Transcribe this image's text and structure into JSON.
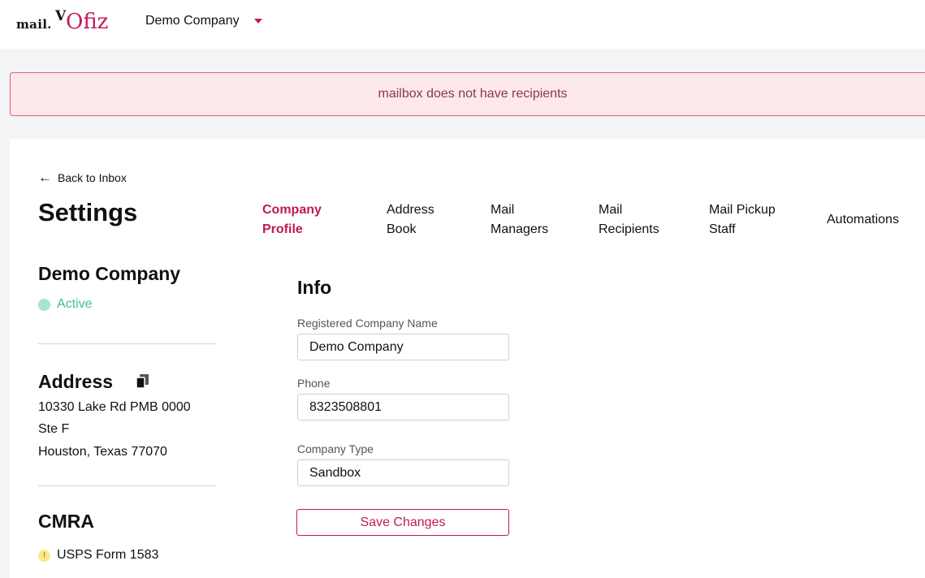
{
  "header": {
    "logo": {
      "prefix": "mail.",
      "v": "V",
      "brand": "Ofiz"
    },
    "company_selector": {
      "name": "Demo Company",
      "icon": "caret-down-icon"
    }
  },
  "alert": {
    "message": "mailbox does not have recipients"
  },
  "nav": {
    "back_label": "Back to Inbox",
    "back_icon": "arrow-left-icon"
  },
  "page": {
    "title": "Settings"
  },
  "tabs": [
    {
      "line1": "Company",
      "line2": "Profile",
      "active": true
    },
    {
      "line1": "Address",
      "line2": "Book"
    },
    {
      "line1": "Mail",
      "line2": "Managers"
    },
    {
      "line1": "Mail",
      "line2": "Recipients"
    },
    {
      "line1": "Mail Pickup",
      "line2": "Staff"
    },
    {
      "line1": "Automations",
      "line2": ""
    }
  ],
  "sidebar": {
    "company_name": "Demo Company",
    "status": "Active",
    "address_title": "Address",
    "address_lines": [
      "10330 Lake Rd PMB 0000",
      "Ste F",
      "Houston, Texas 77070"
    ],
    "cmra_title": "CMRA",
    "cmra_item": "USPS Form 1583",
    "cmra_icon": "warning-icon"
  },
  "info": {
    "title": "Info",
    "fields": [
      {
        "label": "Registered Company Name",
        "value": "Demo Company"
      },
      {
        "label": "Phone",
        "value": "8323508801"
      },
      {
        "label": "Company Type",
        "value": "Sandbox"
      }
    ],
    "save_label": "Save Changes"
  },
  "colors": {
    "accent": "#c2185b",
    "active_status": "#3fbf8f",
    "alert_bg": "#fde8ec",
    "alert_border": "#e0607a"
  }
}
